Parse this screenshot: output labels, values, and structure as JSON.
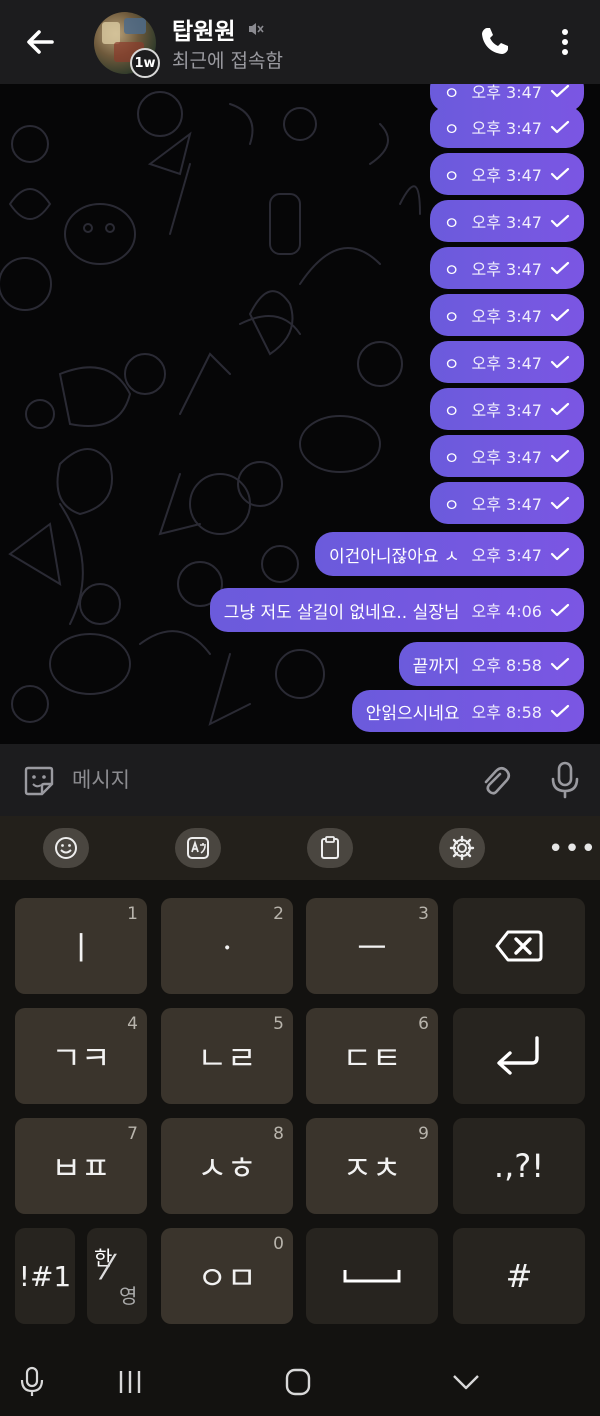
{
  "header": {
    "contact_name": "탑원원",
    "status": "최근에 접속함",
    "story_badge": "1w"
  },
  "messages": [
    {
      "text": "ㅇ",
      "time": "오후 3:47"
    },
    {
      "text": "ㅇ",
      "time": "오후 3:47"
    },
    {
      "text": "ㅇ",
      "time": "오후 3:47"
    },
    {
      "text": "ㅇ",
      "time": "오후 3:47"
    },
    {
      "text": "ㅇ",
      "time": "오후 3:47"
    },
    {
      "text": "ㅇ",
      "time": "오후 3:47"
    },
    {
      "text": "ㅇ",
      "time": "오후 3:47"
    },
    {
      "text": "ㅇ",
      "time": "오후 3:47"
    },
    {
      "text": "ㅇ",
      "time": "오후 3:47"
    },
    {
      "text": "ㅇ",
      "time": "오후 3:47"
    },
    {
      "text": "이건아니잖아요 ㅅ",
      "time": "오후 3:47"
    },
    {
      "text": "그냥 저도 살길이 없네요.. 실장님",
      "time": "오후 4:06"
    },
    {
      "text": "끝까지",
      "time": "오후 8:58"
    },
    {
      "text": "안읽으시네요",
      "time": "오후 8:58"
    }
  ],
  "input": {
    "placeholder": "메시지"
  },
  "keyboard": {
    "keys": [
      {
        "label": "ㅣ",
        "num": "1"
      },
      {
        "label": "ㆍ",
        "num": "2"
      },
      {
        "label": "ㅡ",
        "num": "3"
      },
      {
        "label": "ㄱㅋ",
        "num": "4"
      },
      {
        "label": "ㄴㄹ",
        "num": "5"
      },
      {
        "label": "ㄷㅌ",
        "num": "6"
      },
      {
        "label": "ㅂㅍ",
        "num": "7"
      },
      {
        "label": "ㅅㅎ",
        "num": "8"
      },
      {
        "label": "ㅈㅊ",
        "num": "9"
      },
      {
        "label": "ㅇㅁ",
        "num": "0"
      }
    ],
    "punct_label": ".,?!",
    "symbols_label": "!#1",
    "lang_top": "한",
    "lang_bottom": "영",
    "hash_label": "#"
  },
  "icons": {
    "back": "arrow-left-icon",
    "call": "phone-icon",
    "more": "more-vertical-icon",
    "mute": "muted-speaker-icon",
    "sticker": "sticker-icon",
    "attach": "paperclip-icon",
    "mic": "microphone-icon",
    "emoji": "emoji-icon",
    "translate": "translate-icon",
    "clipboard": "clipboard-icon",
    "settings": "gear-icon",
    "backspace": "backspace-icon",
    "enter": "enter-icon",
    "space": "space-icon"
  },
  "colors": {
    "bubble": "#7058e0",
    "header": "#1c1c1e",
    "key": "#3a342c"
  }
}
